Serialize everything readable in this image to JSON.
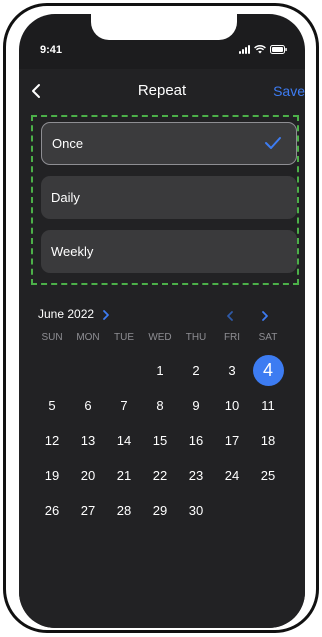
{
  "status": {
    "time": "9:41"
  },
  "header": {
    "title": "Repeat",
    "save_label": "Save",
    "back_icon": "chevron-left-icon"
  },
  "options": [
    {
      "label": "Once",
      "selected": true
    },
    {
      "label": "Daily",
      "selected": false
    },
    {
      "label": "Weekly",
      "selected": false
    }
  ],
  "calendar": {
    "month_label": "June 2022",
    "weekdays": [
      "SUN",
      "MON",
      "TUE",
      "WED",
      "THU",
      "FRI",
      "SAT"
    ],
    "leading_blanks": 3,
    "days": [
      "1",
      "2",
      "3",
      "4",
      "5",
      "6",
      "7",
      "8",
      "9",
      "10",
      "11",
      "12",
      "13",
      "14",
      "15",
      "16",
      "17",
      "18",
      "19",
      "20",
      "21",
      "22",
      "23",
      "24",
      "25",
      "26",
      "27",
      "28",
      "29",
      "30"
    ],
    "selected_day": "4"
  },
  "colors": {
    "accent": "#3d7cf2",
    "background": "#1c1c1e",
    "card": "#3a3a3c",
    "outline": "#4cb049"
  }
}
